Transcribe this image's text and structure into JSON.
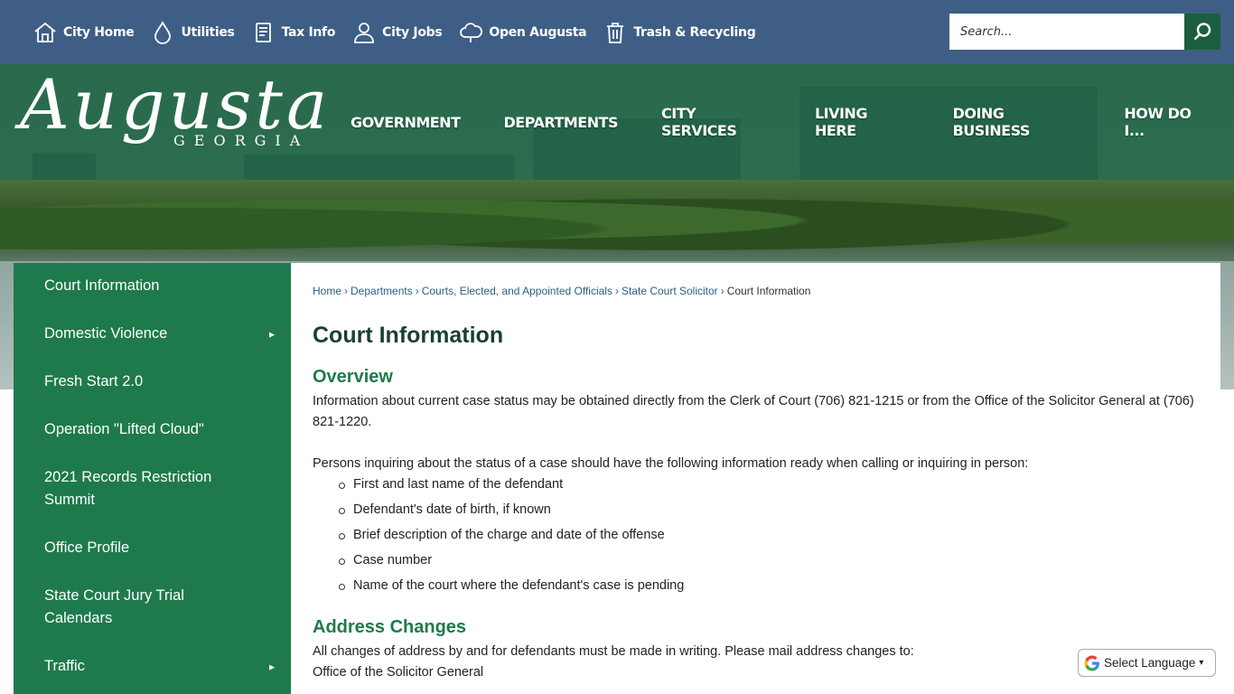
{
  "utility_nav": [
    {
      "label": "City Home",
      "icon": "house-icon"
    },
    {
      "label": "Utilities",
      "icon": "water-drop-icon"
    },
    {
      "label": "Tax Info",
      "icon": "document-icon"
    },
    {
      "label": "City Jobs",
      "icon": "person-icon"
    },
    {
      "label": "Open Augusta",
      "icon": "cloud-icon"
    },
    {
      "label": "Trash & Recycling",
      "icon": "trash-can-icon"
    }
  ],
  "search": {
    "placeholder": "Search..."
  },
  "logo": {
    "script": "Augusta",
    "sub": "GEORGIA"
  },
  "main_nav": [
    "GOVERNMENT",
    "DEPARTMENTS",
    "CITY SERVICES",
    "LIVING HERE",
    "DOING BUSINESS",
    "HOW DO I..."
  ],
  "sidebar": {
    "items": [
      {
        "label": "Court Information",
        "has_submenu": false
      },
      {
        "label": "Domestic Violence",
        "has_submenu": true
      },
      {
        "label": "Fresh Start 2.0",
        "has_submenu": false
      },
      {
        "label": "Operation \"Lifted Cloud\"",
        "has_submenu": false
      },
      {
        "label": "2021 Records Restriction Summit",
        "has_submenu": false
      },
      {
        "label": "Office Profile",
        "has_submenu": false
      },
      {
        "label": "State Court Jury Trial Calendars",
        "has_submenu": false
      },
      {
        "label": "Traffic",
        "has_submenu": true
      }
    ],
    "arrow": "►"
  },
  "breadcrumb": [
    "Home",
    "Departments",
    "Courts, Elected, and Appointed Officials",
    "State Court Solicitor",
    "Court Information"
  ],
  "breadcrumb_sep": "›",
  "page_title": "Court Information",
  "overview": {
    "title": "Overview",
    "para1": "Information about current case status may be obtained directly from the Clerk of Court (706) 821-1215 or from the Office of the Solicitor General at (706) 821-1220.",
    "para2": "Persons inquiring about the status of a case should have the following information ready when calling or inquiring in person:",
    "list": [
      "First and last name of the defendant",
      "Defendant's date of birth, if known",
      "Brief description of the charge and date of the offense",
      "Case number",
      "Name of the court where the defendant's case is pending"
    ]
  },
  "address": {
    "title": "Address Changes",
    "line1": "All changes of address by and for defendants must be made in writing. Please mail address changes to:",
    "line2": "Office of the Solicitor General"
  },
  "translate": {
    "label": "Select Language",
    "caret": "▾"
  },
  "colors": {
    "topbar": "#3e5e86",
    "green": "#1e7a4c",
    "title": "#1b3e35",
    "link": "#2a5f86"
  }
}
